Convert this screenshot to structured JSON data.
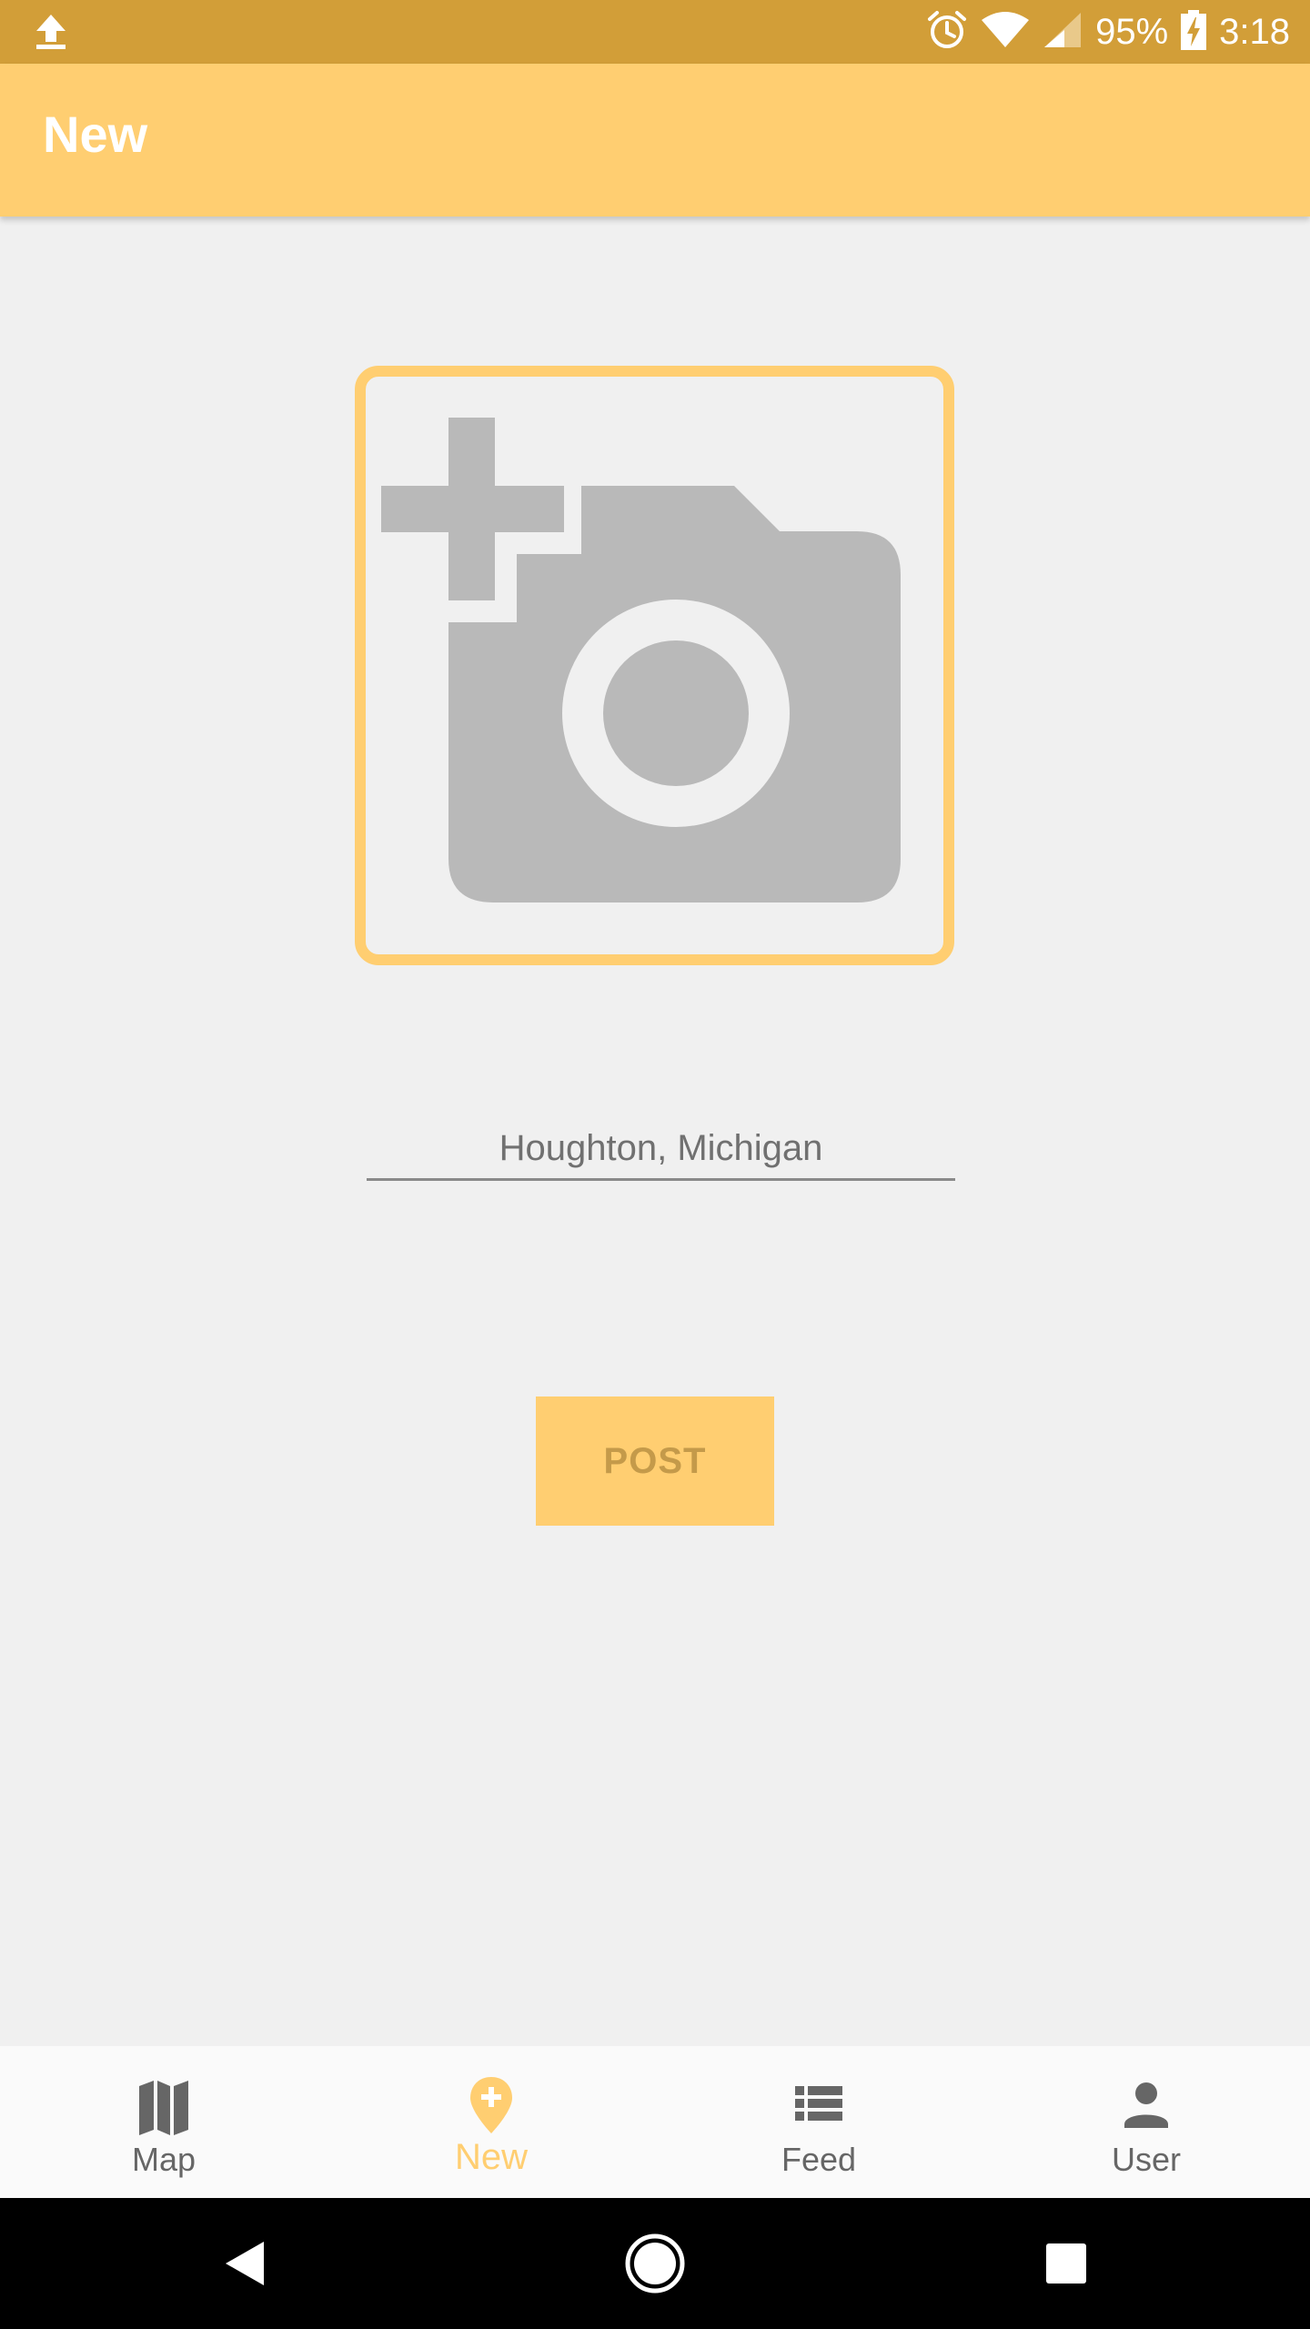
{
  "status_bar": {
    "battery": "95%",
    "time": "3:18",
    "icons": [
      "upload-icon",
      "alarm-icon",
      "wifi-icon",
      "signal-icon",
      "battery-charging-icon"
    ]
  },
  "app_bar": {
    "title": "New"
  },
  "photo_picker": {
    "icon": "add-a-photo-icon"
  },
  "location_field": {
    "value": "Houghton, Michigan"
  },
  "post_button": {
    "label": "POST"
  },
  "bottom_nav": {
    "items": [
      {
        "label": "Map",
        "icon": "map-icon",
        "active": false
      },
      {
        "label": "New",
        "icon": "add-location-icon",
        "active": true
      },
      {
        "label": "Feed",
        "icon": "list-icon",
        "active": false
      },
      {
        "label": "User",
        "icon": "person-icon",
        "active": false
      }
    ]
  },
  "system_nav": {
    "icons": [
      "back-icon",
      "home-icon",
      "recents-icon"
    ]
  },
  "colors": {
    "status_bar": "#d29e38",
    "accent": "#ffce71",
    "background": "#f0f0f0",
    "icon_grey": "#b9b9b9",
    "nav_inactive": "#666666"
  }
}
